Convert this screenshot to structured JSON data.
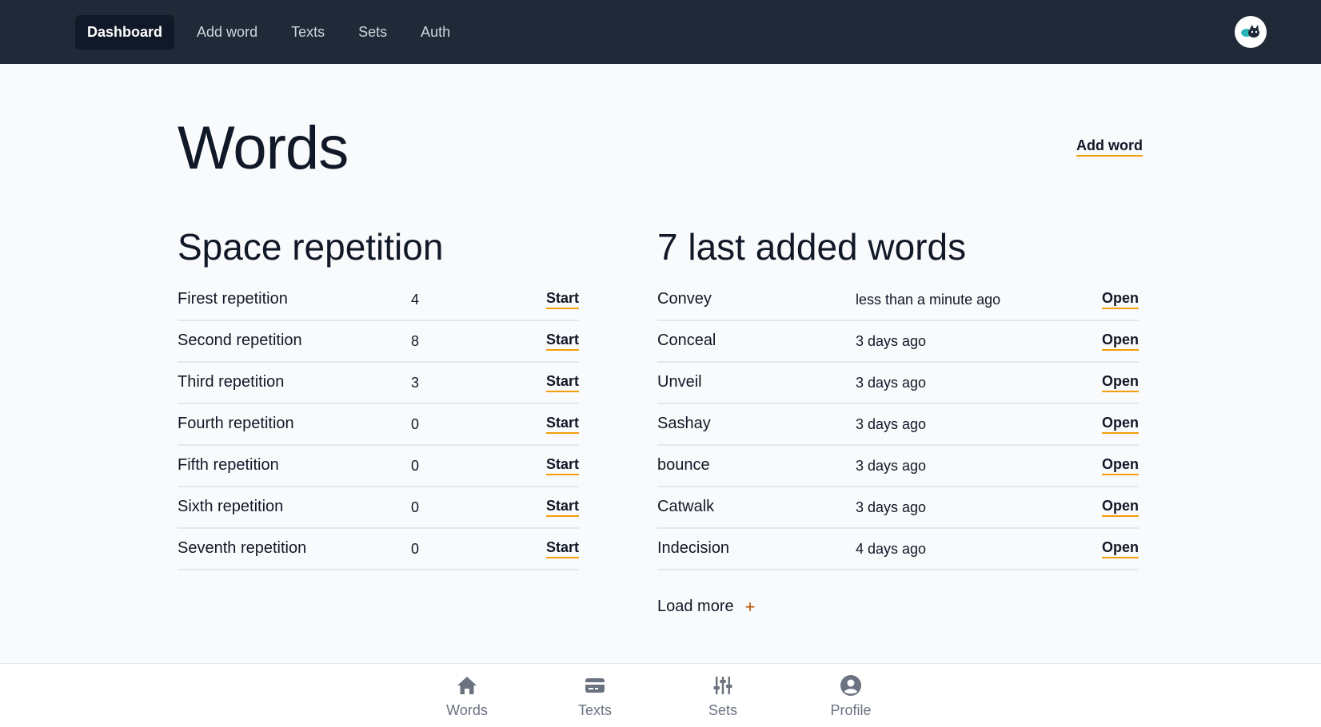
{
  "topnav": {
    "items": [
      {
        "label": "Dashboard",
        "active": true
      },
      {
        "label": "Add word",
        "active": false
      },
      {
        "label": "Texts",
        "active": false
      },
      {
        "label": "Sets",
        "active": false
      },
      {
        "label": "Auth",
        "active": false
      }
    ],
    "avatar_icon": "cat-avatar-icon"
  },
  "main": {
    "title": "Words",
    "add_word_link": "Add word",
    "repetition": {
      "title": "Space repetition",
      "rows": [
        {
          "name": "Firest repetition",
          "count": "4",
          "action": "Start"
        },
        {
          "name": "Second repetition",
          "count": "8",
          "action": "Start"
        },
        {
          "name": "Third repetition",
          "count": "3",
          "action": "Start"
        },
        {
          "name": "Fourth repetition",
          "count": "0",
          "action": "Start"
        },
        {
          "name": "Fifth repetition",
          "count": "0",
          "action": "Start"
        },
        {
          "name": "Sixth repetition",
          "count": "0",
          "action": "Start"
        },
        {
          "name": "Seventh repetition",
          "count": "0",
          "action": "Start"
        }
      ]
    },
    "last_words": {
      "title": "7 last added words",
      "rows": [
        {
          "word": "Convey",
          "added": "less than a minute ago",
          "action": "Open"
        },
        {
          "word": "Conceal",
          "added": "3 days ago",
          "action": "Open"
        },
        {
          "word": "Unveil",
          "added": "3 days ago",
          "action": "Open"
        },
        {
          "word": "Sashay",
          "added": "3 days ago",
          "action": "Open"
        },
        {
          "word": "bounce",
          "added": "3 days ago",
          "action": "Open"
        },
        {
          "word": "Catwalk",
          "added": "3 days ago",
          "action": "Open"
        },
        {
          "word": "Indecision",
          "added": "4 days ago",
          "action": "Open"
        }
      ],
      "load_more": "Load more"
    }
  },
  "bottomnav": {
    "items": [
      {
        "label": "Words",
        "icon": "home-icon"
      },
      {
        "label": "Texts",
        "icon": "card-icon"
      },
      {
        "label": "Sets",
        "icon": "sliders-icon"
      },
      {
        "label": "Profile",
        "icon": "user-circle-icon"
      }
    ]
  },
  "colors": {
    "nav_bg": "#1f2937",
    "accent_underline": "#f59e0b",
    "page_bg": "#f9fafb"
  }
}
